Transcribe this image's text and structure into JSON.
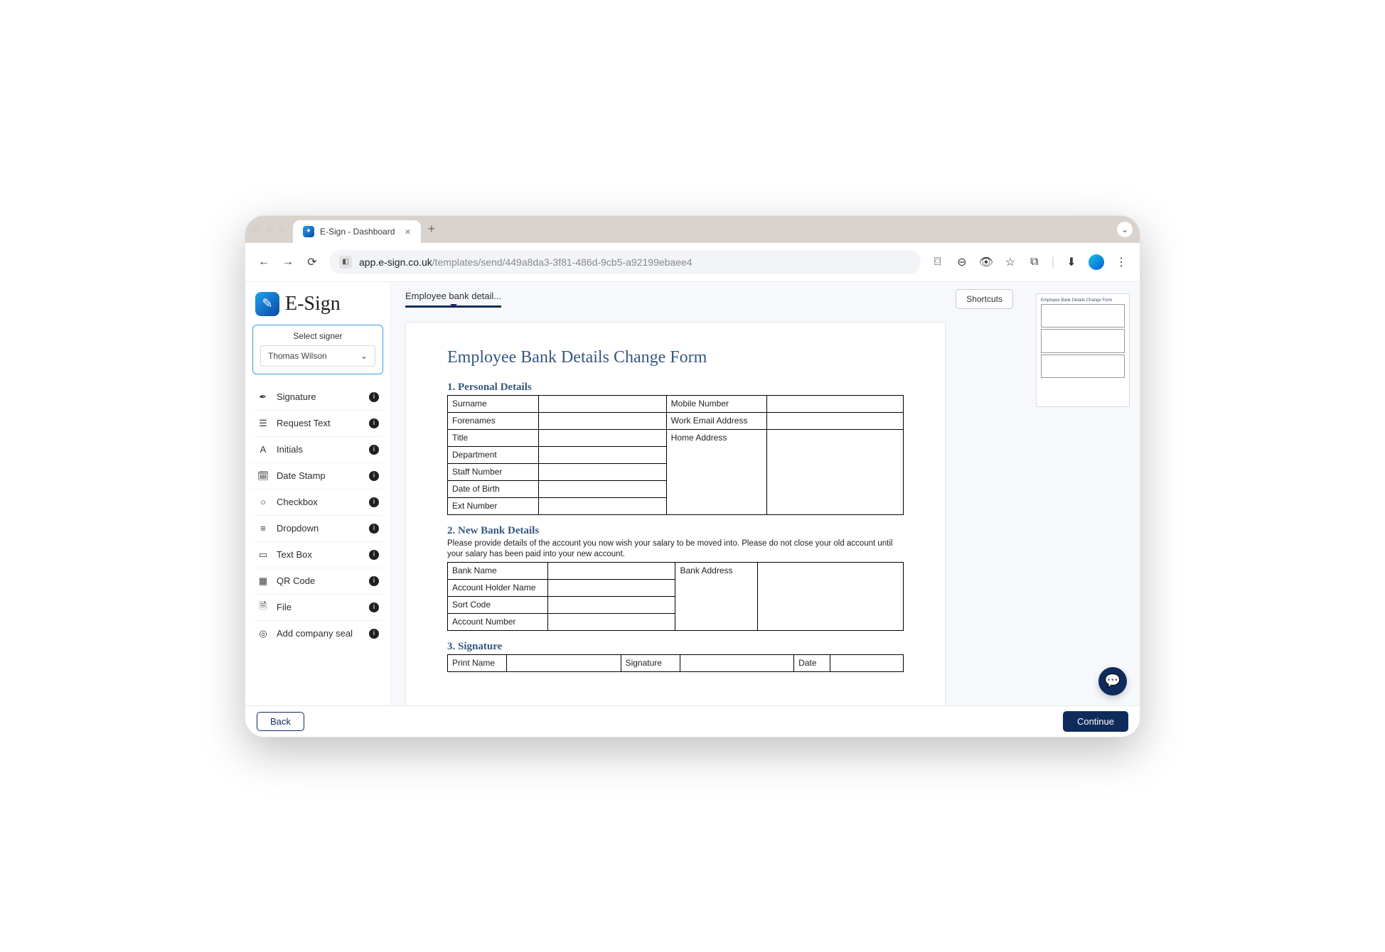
{
  "browser": {
    "tab_title": "E-Sign - Dashboard",
    "url_host": "app.e-sign.co.uk",
    "url_path": "/templates/send/449a8da3-3f81-486d-9cb5-a92199ebaee4"
  },
  "logo_text": "E-Sign",
  "signer": {
    "label": "Select signer",
    "selected": "Thomas Wilson"
  },
  "fields": [
    {
      "label": "Signature",
      "icon": "signature"
    },
    {
      "label": "Request Text",
      "icon": "request-text"
    },
    {
      "label": "Initials",
      "icon": "initials"
    },
    {
      "label": "Date Stamp",
      "icon": "date"
    },
    {
      "label": "Checkbox",
      "icon": "checkbox"
    },
    {
      "label": "Dropdown",
      "icon": "dropdown"
    },
    {
      "label": "Text Box",
      "icon": "textbox"
    },
    {
      "label": "QR Code",
      "icon": "qr"
    },
    {
      "label": "File",
      "icon": "file"
    },
    {
      "label": "Add company seal",
      "icon": "seal"
    }
  ],
  "doc_tab": "Employee bank detail...",
  "shortcuts_label": "Shortcuts",
  "document": {
    "title": "Employee Bank Details Change Form",
    "sections": {
      "s1": {
        "heading": "1. Personal Details",
        "left_labels": [
          "Surname",
          "Forenames",
          "Title",
          "Department",
          "Staff Number",
          "Date of Birth",
          "Ext Number"
        ],
        "right_labels": [
          "Mobile Number",
          "Work Email Address",
          "Home Address"
        ]
      },
      "s2": {
        "heading": "2. New Bank Details",
        "note": "Please provide details of the account you now wish your salary to be moved into.  Please do not close your old account until your salary has been paid into your new account.",
        "left_labels": [
          "Bank Name",
          "Account Holder Name",
          "Sort Code",
          "Account Number"
        ],
        "right_labels": [
          "Bank Address"
        ]
      },
      "s3": {
        "heading": "3. Signature",
        "cols": [
          "Print Name",
          "Signature",
          "Date"
        ]
      }
    }
  },
  "footer": {
    "back": "Back",
    "continue": "Continue"
  }
}
